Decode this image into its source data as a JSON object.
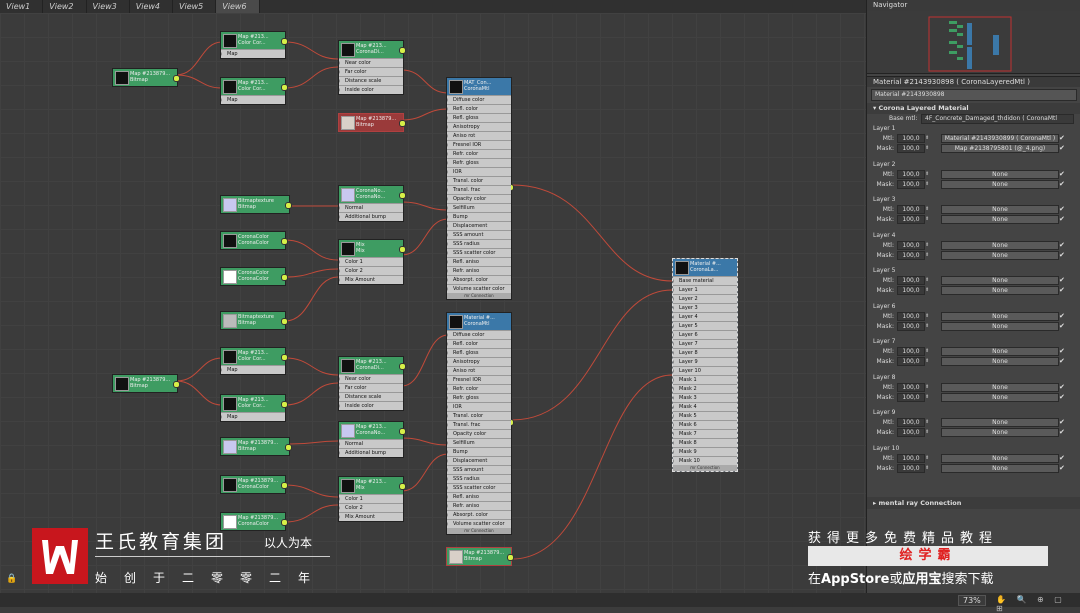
{
  "tabs": [
    "View1",
    "View2",
    "View3",
    "View4",
    "View5",
    "View6"
  ],
  "active_tab": 5,
  "navigator_title": "Navigator",
  "material_header": "Material #2143930898  ( CoronaLayeredMtl )",
  "material_name": "Material #2143930898",
  "rollout_title": "Corona Layered Material",
  "base_mtl_label": "Base mtl:",
  "base_mtl_value": "4F_Concrete_Damaged_thdidon  ( CoronaMtl",
  "layers": [
    {
      "name": "Layer 1",
      "mtl_amount": "100,0",
      "mtl": "Material #2143930899  ( CoronaMtl )",
      "mask_amount": "100,0",
      "mask": "Map #2138795801 (@_4.png)"
    },
    {
      "name": "Layer 2",
      "mtl_amount": "100,0",
      "mtl": "None",
      "mask_amount": "100,0",
      "mask": "None"
    },
    {
      "name": "Layer 3",
      "mtl_amount": "100,0",
      "mtl": "None",
      "mask_amount": "100,0",
      "mask": "None"
    },
    {
      "name": "Layer 4",
      "mtl_amount": "100,0",
      "mtl": "None",
      "mask_amount": "100,0",
      "mask": "None"
    },
    {
      "name": "Layer 5",
      "mtl_amount": "100,0",
      "mtl": "None",
      "mask_amount": "100,0",
      "mask": "None"
    },
    {
      "name": "Layer 6",
      "mtl_amount": "100,0",
      "mtl": "None",
      "mask_amount": "100,0",
      "mask": "None"
    },
    {
      "name": "Layer 7",
      "mtl_amount": "100,0",
      "mtl": "None",
      "mask_amount": "100,0",
      "mask": "None"
    },
    {
      "name": "Layer 8",
      "mtl_amount": "100,0",
      "mtl": "None",
      "mask_amount": "100,0",
      "mask": "None"
    },
    {
      "name": "Layer 9",
      "mtl_amount": "100,0",
      "mtl": "None",
      "mask_amount": "100,0",
      "mask": "None"
    },
    {
      "name": "Layer 10",
      "mtl_amount": "100,0",
      "mtl": "None",
      "mask_amount": "100,0",
      "mask": "None"
    }
  ],
  "mtl_label": "Mtl:",
  "mask_label": "Mask:",
  "mental_ray": "mental ray Connection",
  "zoom": "73%",
  "nodes": {
    "bitmap_a": {
      "title": "Map #213879...",
      "sub": "Bitmap"
    },
    "color_a1": {
      "title": "Map #213...",
      "sub": "Color Cor...",
      "rows": [
        "Map"
      ]
    },
    "color_a2": {
      "title": "Map #213...",
      "sub": "Color Cor...",
      "rows": [
        "Map"
      ]
    },
    "coronadi_a": {
      "title": "Map #213...",
      "sub": "CoronaDi...",
      "rows": [
        "Near color",
        "Far color",
        "Distance scale",
        "Inside color"
      ]
    },
    "bitmap_red_a": {
      "title": "Map #213879...",
      "sub": "Bitmap"
    },
    "coronamtl_a": {
      "title": "MAT_Con...",
      "sub": "CoronaMtl",
      "rows": [
        "Diffuse color",
        "Refl. color",
        "Refl. gloss",
        "Anisotropy",
        "Aniso rot",
        "Fresnel IOR",
        "Refr. color",
        "Refr. gloss",
        "IOR",
        "Transl. color",
        "Transl. frac",
        "Opacity color",
        "Selfillum",
        "Bump",
        "Displacement",
        "SSS amount",
        "SSS radius",
        "SSS scatter color",
        "Refl. aniso",
        "Refr. aniso",
        "Absorpt. color",
        "Volume scatter color"
      ],
      "foot": "mr Connection"
    },
    "bitmaptex_a": {
      "title": "Bitmaptexture",
      "sub": "Bitmap"
    },
    "coronanormal_a": {
      "title": "CoronaNo...",
      "sub": "CoronaNo...",
      "rows": [
        "Normal",
        "Additional bump"
      ]
    },
    "coronacolor_a1": {
      "title": "CoronaColor",
      "sub": "CoronaColor"
    },
    "coronacolor_a2": {
      "title": "CoronaColor",
      "sub": "CoronaColor"
    },
    "mix_a": {
      "title": "Mix",
      "sub": "Mix",
      "rows": [
        "Color 1",
        "Color 2",
        "Mix Amount"
      ]
    },
    "bitmaptex_a2": {
      "title": "Bitmaptexture",
      "sub": "Bitmap"
    },
    "bitmap_b": {
      "title": "Map #213879...",
      "sub": "Bitmap"
    },
    "color_b1": {
      "title": "Map #213...",
      "sub": "Color Cor...",
      "rows": [
        "Map"
      ]
    },
    "color_b2": {
      "title": "Map #213...",
      "sub": "Color Cor...",
      "rows": [
        "Map"
      ]
    },
    "coronadi_b": {
      "title": "Map #213...",
      "sub": "CoronaDi...",
      "rows": [
        "Near color",
        "Far color",
        "Distance scale",
        "Inside color"
      ]
    },
    "coronamtl_b": {
      "title": "Material #...",
      "sub": "CoronaMtl",
      "rows": [
        "Diffuse color",
        "Refl. color",
        "Refl. gloss",
        "Anisotropy",
        "Aniso rot",
        "Fresnel IOR",
        "Refr. color",
        "Refr. gloss",
        "IOR",
        "Transl. color",
        "Transl. frac",
        "Opacity color",
        "Selfillum",
        "Bump",
        "Displacement",
        "SSS amount",
        "SSS radius",
        "SSS scatter color",
        "Refl. aniso",
        "Refr. aniso",
        "Absorpt. color",
        "Volume scatter color"
      ],
      "foot": "mr Connection"
    },
    "bitmap_b2": {
      "title": "Map #213879...",
      "sub": "Bitmap"
    },
    "coronanormal_b": {
      "title": "Map #213...",
      "sub": "CoronaNo...",
      "rows": [
        "Normal",
        "Additional bump"
      ]
    },
    "coronacolor_b1": {
      "title": "Map #213879...",
      "sub": "CoronaColor"
    },
    "coronacolor_b2": {
      "title": "Map #213879...",
      "sub": "CoronaColor"
    },
    "mix_b": {
      "title": "Map #213...",
      "sub": "Mix",
      "rows": [
        "Color 1",
        "Color 2",
        "Mix Amount"
      ]
    },
    "bitmap_b3": {
      "title": "Map #213879...",
      "sub": "Bitmap"
    },
    "layered": {
      "title": "Material #...",
      "sub": "CoronaLa...",
      "rows": [
        "Base material",
        "Layer 1",
        "Layer 2",
        "Layer 3",
        "Layer 4",
        "Layer 5",
        "Layer 6",
        "Layer 7",
        "Layer 8",
        "Layer 9",
        "Layer 10",
        "Mask 1",
        "Mask 2",
        "Mask 3",
        "Mask 4",
        "Mask 5",
        "Mask 6",
        "Mask 7",
        "Mask 8",
        "Mask 9",
        "Mask 10"
      ],
      "foot": "mr Connection"
    }
  },
  "watermark": {
    "org": "王氏教育集团",
    "slogan": "以人为本",
    "founded": "始创于二零零二年",
    "promo_line1": "获得更多免费精品教程",
    "promo_brand": "绘学霸",
    "promo_line3_a": "在",
    "promo_line3_b": "AppStore",
    "promo_line3_c": "或",
    "promo_line3_d": "应用宝",
    "promo_line3_e": "搜索下载"
  },
  "colors": {
    "node_green": "#3e9c62",
    "node_blue": "#3b78a8",
    "wire": "#c04a3a",
    "logo_red": "#c8161d",
    "promo_red": "#e02020"
  }
}
